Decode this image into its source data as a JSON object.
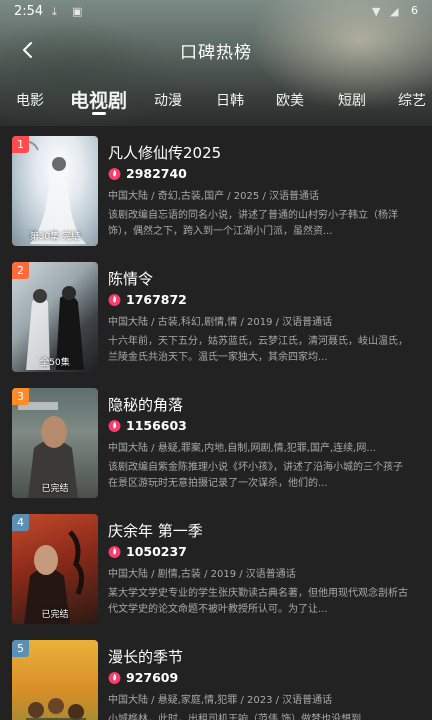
{
  "status_bar": {
    "time": "2:54",
    "battery": "6"
  },
  "header": {
    "title": "口碑热榜"
  },
  "tabs": [
    "电影",
    "电视剧",
    "动漫",
    "日韩",
    "欧美",
    "短剧",
    "综艺"
  ],
  "active_tab": "电视剧",
  "colors": {
    "rank_1": "#ff4d4f",
    "rank_2": "#ff6a3d",
    "rank_3": "#ff8a2a",
    "rank_other": "#5b8fb3",
    "heat_icon": "#ff3b6b"
  },
  "items": [
    {
      "rank": "1",
      "title": "凡人修仙传2025",
      "heat": "2982740",
      "meta": "中国大陆 / 奇幻,古装,国产 / 2025 / 汉语普通话",
      "desc": "该剧改编自忘语的同名小说，讲述了普通的山村穷小子韩立（杨洋饰），偶然之下，跨入到一个江湖小门派，虽然资...",
      "poster_caption": "第30集 完结"
    },
    {
      "rank": "2",
      "title": "陈情令",
      "heat": "1767872",
      "meta": "中国大陆 / 古装,科幻,剧情,情 / 2019 / 汉语普通话",
      "desc": "十六年前，天下五分，姑苏蓝氏，云梦江氏，清河聂氏，岐山温氏，兰陵金氏共治天下。温氏一家独大，其余四家均...",
      "poster_caption": "全50集"
    },
    {
      "rank": "3",
      "title": "隐秘的角落",
      "heat": "1156603",
      "meta": "中国大陆 / 悬疑,罪案,内地,自制,网剧,情,犯罪,国产,连续,网...",
      "desc": "该剧改编自紫金陈推理小说《坏小孩》，讲述了沿海小城的三个孩子在景区游玩时无意拍摄记录了一次谋杀，他们的...",
      "poster_caption": "已完结"
    },
    {
      "rank": "4",
      "title": "庆余年 第一季",
      "heat": "1050237",
      "meta": "中国大陆 / 剧情,古装 / 2019 / 汉语普通话",
      "desc": "某大学文学史专业的学生张庆勤读古典名著，但他用现代观念剖析古代文学史的论文命题不被叶教授所认可。为了让...",
      "poster_caption": "已完结"
    },
    {
      "rank": "5",
      "title": "漫长的季节",
      "heat": "927609",
      "meta": "中国大陆 / 悬疑,家庭,情,犯罪 / 2023 / 汉语普通话",
      "desc": "小城桦林，此时，出租司机王响（范伟 饰）做梦也没想到...",
      "poster_caption": ""
    }
  ]
}
